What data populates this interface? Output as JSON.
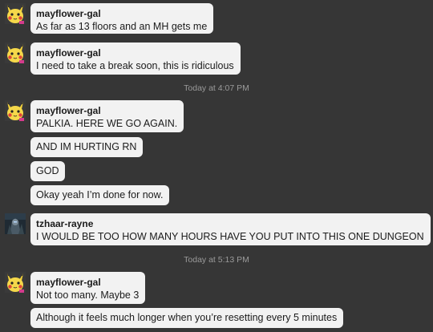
{
  "conversation": {
    "messages": [
      {
        "username": "mayflower-gal",
        "lines": [
          "As far as 13 floors and an MH gets me"
        ]
      },
      {
        "username": "mayflower-gal",
        "lines": [
          "I need to take a break soon, this is ridiculous"
        ]
      },
      {
        "username": "mayflower-gal",
        "lines": [
          "PALKIA. HERE WE GO AGAIN."
        ]
      },
      {
        "username": "",
        "lines": [
          "AND IM HURTING RN"
        ]
      },
      {
        "username": "",
        "lines": [
          "GOD"
        ]
      },
      {
        "username": "",
        "lines": [
          "Okay yeah I’m done for now."
        ]
      },
      {
        "username": "tzhaar-rayne",
        "lines": [
          "I WOULD BE TOO HOW MANY HOURS HAVE YOU PUT INTO THIS ONE DUNGEON"
        ]
      },
      {
        "username": "mayflower-gal",
        "lines": [
          "Not too many. Maybe 3"
        ]
      },
      {
        "username": "",
        "lines": [
          "Although it feels much longer when you’re resetting every 5 minutes"
        ]
      }
    ],
    "timestamps": [
      "Today at 4:07 PM",
      "Today at 5:13 PM"
    ]
  },
  "colors": {
    "background": "#363636",
    "bubble": "#f2f2f2",
    "text": "#1b1b1b",
    "timestamp": "#9a9a9a"
  },
  "icons": {
    "mayflower_avatar": "pikachu-avatar-icon",
    "tzhaar_avatar": "dark-character-avatar-icon"
  }
}
